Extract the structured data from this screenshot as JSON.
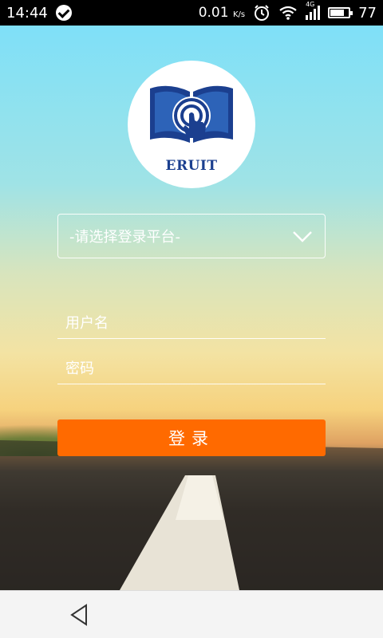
{
  "status_bar": {
    "time": "14:44",
    "net_speed": "0.01",
    "net_unit": "K/s",
    "network_type": "4G",
    "battery": "77",
    "battery_level": 0.77
  },
  "logo": {
    "text": "ERUIT"
  },
  "form": {
    "platform_select": "-请选择登录平台-",
    "username_placeholder": "用户名",
    "password_placeholder": "密码",
    "login_label": "登录"
  },
  "colors": {
    "accent": "#ff6a00",
    "logo_blue": "#1b3f8f"
  }
}
